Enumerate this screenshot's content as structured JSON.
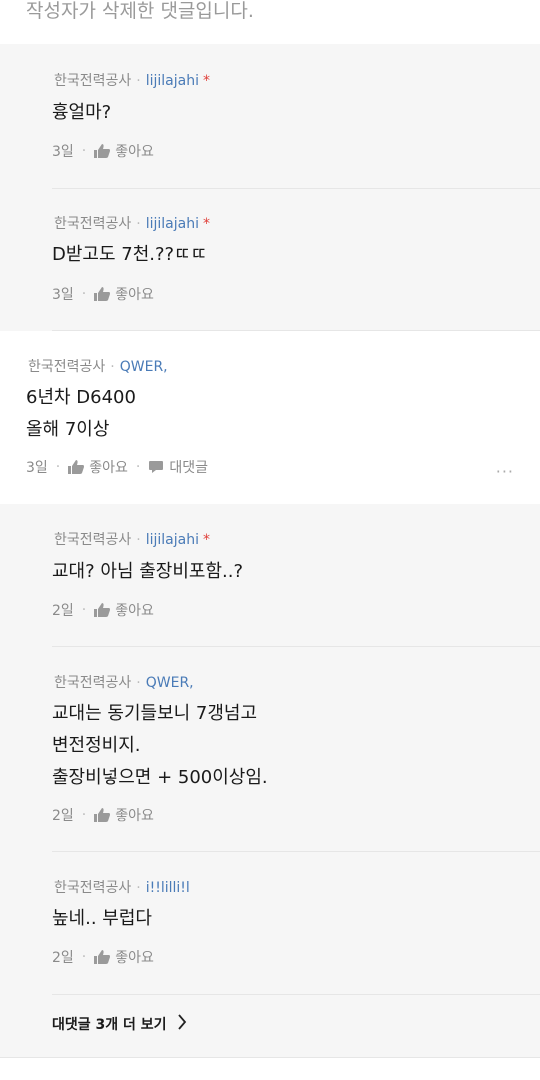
{
  "deleted_notice": "작성자가 삭제한 댓글입니다.",
  "comments": [
    {
      "company": "한국전력공사",
      "user": "lijilajahi",
      "author_mark": "*",
      "lines": [
        "흉얼마?"
      ],
      "time": "3일",
      "like_label": "좋아요"
    },
    {
      "company": "한국전력공사",
      "user": "lijilajahi",
      "author_mark": "*",
      "lines": [
        "D받고도 7천.??ㄸㄸ"
      ],
      "time": "3일",
      "like_label": "좋아요"
    },
    {
      "company": "한국전력공사",
      "user": "QWER,",
      "lines": [
        "6년차 D6400",
        "올해 7이상"
      ],
      "time": "3일",
      "like_label": "좋아요",
      "reply_label": "대댓글",
      "more_label": "···"
    },
    {
      "company": "한국전력공사",
      "user": "lijilajahi",
      "author_mark": "*",
      "lines": [
        "교대? 아님 출장비포함..?"
      ],
      "time": "2일",
      "like_label": "좋아요"
    },
    {
      "company": "한국전력공사",
      "user": "QWER,",
      "lines": [
        "교대는 동기들보니 7갱넘고",
        "변전정비지.",
        "출장비넣으면 + 500이상임."
      ],
      "time": "2일",
      "like_label": "좋아요"
    },
    {
      "company": "한국전력공사",
      "user": "i!!lilli!l",
      "lines": [
        "높네.. 부럽다"
      ],
      "time": "2일",
      "like_label": "좋아요"
    }
  ],
  "load_more_label": "대댓글 3개 더 보기",
  "icons": {
    "like": "thumbs-up-icon",
    "reply": "speech-bubble-icon",
    "load_more": "chevron-right-icon"
  },
  "colors": {
    "user": "#4a7bb7",
    "author_mark": "#e0403a",
    "reply_bg": "#f6f6f6"
  }
}
